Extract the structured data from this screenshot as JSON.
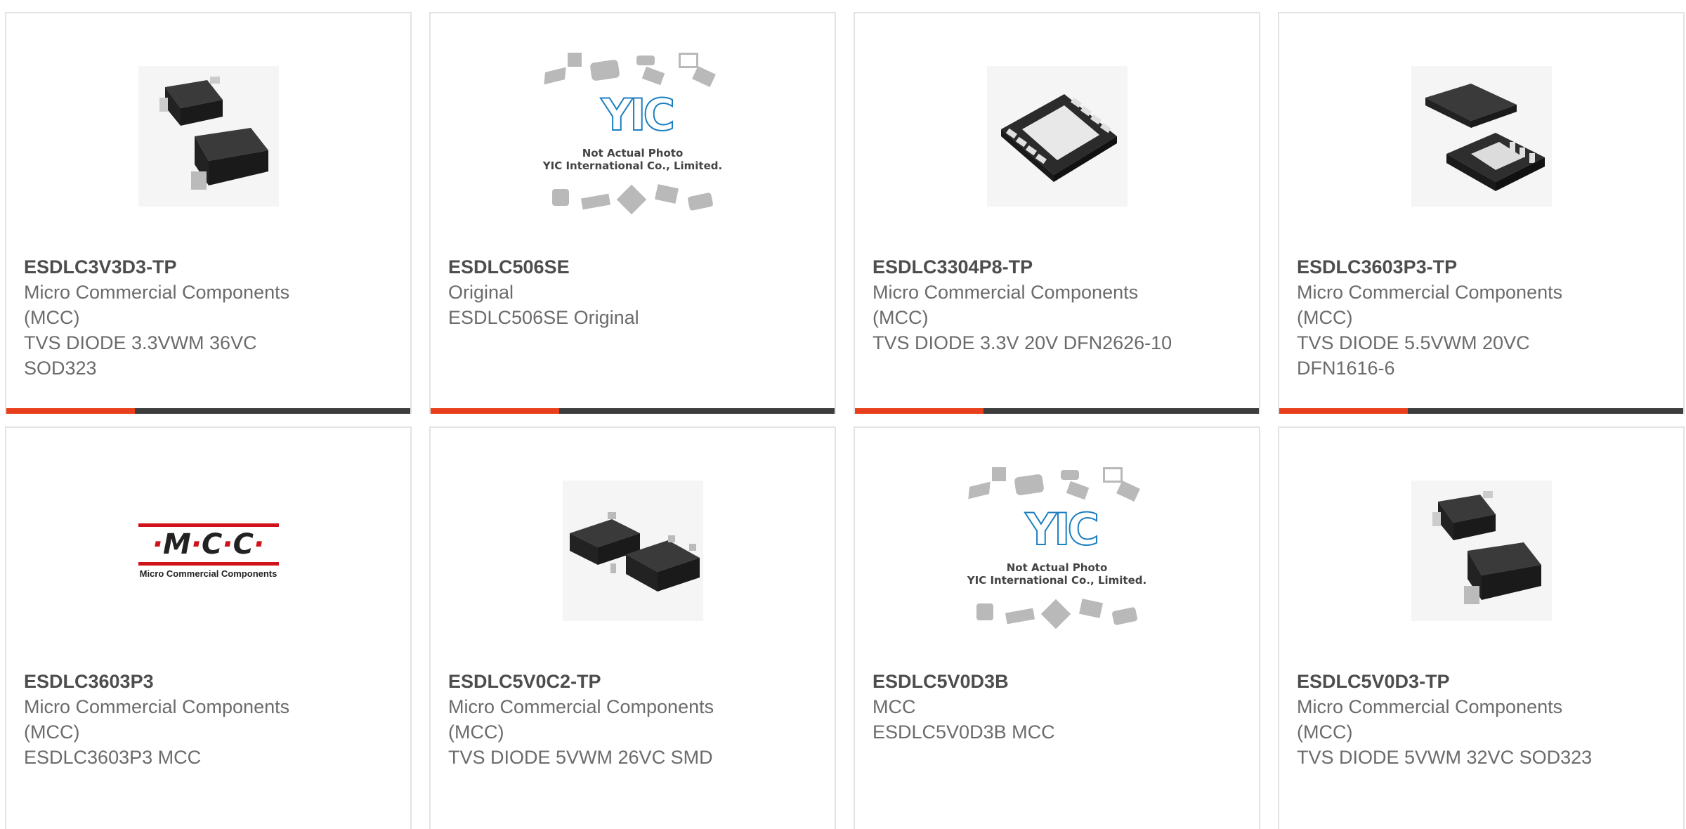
{
  "colors": {
    "accent": "#e8401c",
    "bar": "#3d3d3d",
    "border": "#e3e3e3"
  },
  "products": [
    {
      "part": "ESDLC3V3D3-TP",
      "mfr": "Micro Commercial Components (MCC)",
      "desc": "TVS DIODE 3.3VWM 36VC SOD323",
      "image": "sod323-photo"
    },
    {
      "part": "ESDLC506SE",
      "mfr": "Original",
      "desc": "ESDLC506SE Original",
      "image": "yic-placeholder"
    },
    {
      "part": "ESDLC3304P8-TP",
      "mfr": "Micro Commercial Components (MCC)",
      "desc": "TVS DIODE 3.3V 20V DFN2626-10",
      "image": "dfn10-photo"
    },
    {
      "part": "ESDLC3603P3-TP",
      "mfr": "Micro Commercial Components (MCC)",
      "desc": "TVS DIODE 5.5VWM 20VC DFN1616-6",
      "image": "dfn6-photo"
    },
    {
      "part": "ESDLC3603P3",
      "mfr": "Micro Commercial Components (MCC)",
      "desc": "ESDLC3603P3 MCC",
      "image": "mcc-logo"
    },
    {
      "part": "ESDLC5V0C2-TP",
      "mfr": "Micro Commercial Components (MCC)",
      "desc": "TVS DIODE 5VWM 26VC SMD",
      "image": "sot23-photo"
    },
    {
      "part": "ESDLC5V0D3B",
      "mfr": "MCC",
      "desc": "ESDLC5V0D3B MCC",
      "image": "yic-placeholder"
    },
    {
      "part": "ESDLC5V0D3-TP",
      "mfr": "Micro Commercial Components (MCC)",
      "desc": "TVS DIODE 5VWM 32VC SOD323",
      "image": "sod323-photo"
    }
  ],
  "yic": {
    "logo": "YIC",
    "line1": "Not Actual Photo",
    "line2": "YIC International Co., Limited."
  },
  "mcc": {
    "wordmark": "M C C",
    "tagline": "Micro Commercial Components"
  }
}
